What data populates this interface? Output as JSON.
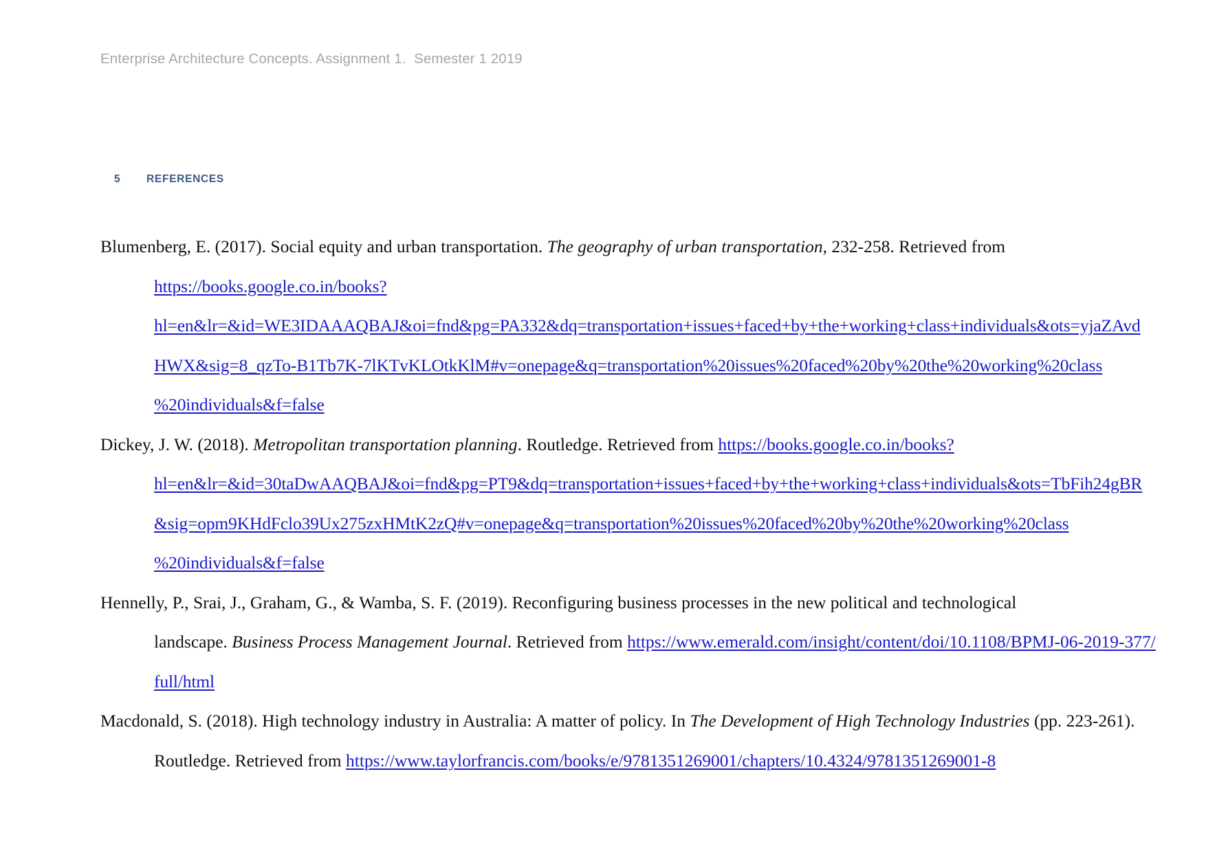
{
  "document": {
    "running_header": "Enterprise Architecture Concepts. Assignment 1.  Semester 1 2019",
    "section": {
      "number": "5",
      "title": "REFERENCES",
      "color": "#3a5a85"
    },
    "link_color": "#1a1aca",
    "header_color": "#a6a6a6"
  },
  "references": [
    {
      "id": "blumenberg-2017",
      "lines": [
        {
          "indent": false,
          "url": false,
          "parts": [
            {
              "text": "Blumenberg, E. (2017). Social equity and urban transportation. ",
              "style": "normal"
            },
            {
              "text": "The geography of urban transportation",
              "style": "italic"
            },
            {
              "text": ", 232-258. Retrieved from",
              "style": "normal"
            }
          ]
        },
        {
          "indent": true,
          "url": true,
          "parts": [
            {
              "text": "https://books.google.co.in/books?",
              "style": "link"
            }
          ]
        },
        {
          "indent": true,
          "url": true,
          "parts": [
            {
              "text": "hl=en&lr=&id=WE3IDAAAQBAJ&oi=fnd&pg=PA332&dq=transportation+issues+faced+by+the+working+class+individuals&ots=yjaZAvd",
              "style": "link"
            }
          ]
        },
        {
          "indent": true,
          "url": true,
          "parts": [
            {
              "text": "HWX&sig=8_qzTo-B1Tb7K-7lKTvKLOtkKlM#v=onepage&q=transportation%20issues%20faced%20by%20the%20working%20class",
              "style": "link"
            }
          ]
        },
        {
          "indent": true,
          "url": true,
          "parts": [
            {
              "text": "%20individuals&f=false",
              "style": "link"
            }
          ]
        }
      ]
    },
    {
      "id": "dickey-2018",
      "lines": [
        {
          "indent": false,
          "url": false,
          "parts": [
            {
              "text": "Dickey, J. W. (2018). ",
              "style": "normal"
            },
            {
              "text": "Metropolitan transportation planning",
              "style": "italic"
            },
            {
              "text": ". Routledge. Retrieved from ",
              "style": "normal"
            },
            {
              "text": "https://books.google.co.in/books?",
              "style": "link"
            }
          ]
        },
        {
          "indent": true,
          "url": true,
          "parts": [
            {
              "text": "hl=en&lr=&id=30taDwAAQBAJ&oi=fnd&pg=PT9&dq=transportation+issues+faced+by+the+working+class+individuals&ots=TbFih24gBR",
              "style": "link"
            }
          ]
        },
        {
          "indent": true,
          "url": true,
          "parts": [
            {
              "text": "&sig=opm9KHdFclo39Ux275zxHMtK2zQ#v=onepage&q=transportation%20issues%20faced%20by%20the%20working%20class",
              "style": "link"
            }
          ]
        },
        {
          "indent": true,
          "url": true,
          "parts": [
            {
              "text": "%20individuals&f=false",
              "style": "link"
            }
          ]
        }
      ]
    },
    {
      "id": "hennelly-2019",
      "lines": [
        {
          "indent": false,
          "url": false,
          "parts": [
            {
              "text": "Hennelly, P., Srai, J., Graham, G., & Wamba, S. F. (2019). Reconfiguring business processes in the new political and technological",
              "style": "normal"
            }
          ]
        },
        {
          "indent": true,
          "url": false,
          "parts": [
            {
              "text": "landscape. ",
              "style": "normal"
            },
            {
              "text": "Business Process Management Journal",
              "style": "italic"
            },
            {
              "text": ". Retrieved from ",
              "style": "normal"
            },
            {
              "text": "https://www.emerald.com/insight/content/doi/10.1108/BPMJ-06-2019-377/",
              "style": "link"
            }
          ]
        },
        {
          "indent": true,
          "url": true,
          "parts": [
            {
              "text": "full/html",
              "style": "link"
            }
          ]
        }
      ]
    },
    {
      "id": "macdonald-2018",
      "lines": [
        {
          "indent": false,
          "url": false,
          "parts": [
            {
              "text": "Macdonald, S. (2018). High technology industry in Australia: A matter of policy. In ",
              "style": "normal"
            },
            {
              "text": "The Development of High Technology Industries",
              "style": "italic"
            },
            {
              "text": " (pp. 223-261).",
              "style": "normal"
            }
          ]
        },
        {
          "indent": true,
          "url": false,
          "parts": [
            {
              "text": "Routledge. Retrieved from ",
              "style": "normal"
            },
            {
              "text": "https://www.taylorfrancis.com/books/e/9781351269001/chapters/10.4324/9781351269001-8",
              "style": "link"
            }
          ]
        }
      ]
    }
  ]
}
